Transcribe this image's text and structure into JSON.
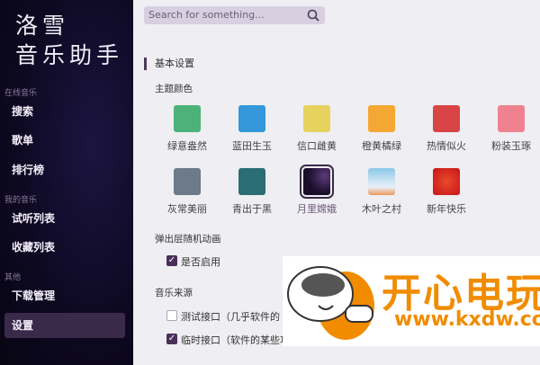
{
  "app": {
    "logo_line1": "洛雪",
    "logo_line2": "音乐助手"
  },
  "sidebar": {
    "groups": [
      {
        "label": "在线音乐"
      },
      {
        "label": "我的音乐"
      },
      {
        "label": "其他"
      }
    ],
    "items": [
      {
        "label": "搜索"
      },
      {
        "label": "歌单"
      },
      {
        "label": "排行榜"
      },
      {
        "label": "试听列表"
      },
      {
        "label": "收藏列表"
      },
      {
        "label": "下载管理"
      },
      {
        "label": "设置"
      }
    ]
  },
  "search": {
    "placeholder": "Search for something..."
  },
  "settings": {
    "section_title": "基本设置",
    "theme_label": "主题颜色",
    "themes": [
      {
        "label": "绿意盎然",
        "color": "#4cb27a"
      },
      {
        "label": "蓝田生玉",
        "color": "#3498db"
      },
      {
        "label": "信口雌黄",
        "color": "#e8d25e"
      },
      {
        "label": "橙黄橘绿",
        "color": "#f5a733"
      },
      {
        "label": "热情似火",
        "color": "#d94444"
      },
      {
        "label": "粉装玉琢",
        "color": "#f0828f"
      },
      {
        "label": "灰常美丽",
        "color": "#6c7a89"
      },
      {
        "label": "青出于黑",
        "color": "#2b6d74"
      },
      {
        "label": "月里嫦娥",
        "color": "#1a0e2a"
      },
      {
        "label": "木叶之村",
        "color": "#8cc8e8"
      },
      {
        "label": "新年快乐",
        "color": "#c8141a"
      }
    ],
    "selected_theme": "月里嫦娥",
    "popup_label": "弹出层随机动画",
    "popup_enable": {
      "label": "是否启用",
      "checked": true
    },
    "source_label": "音乐来源",
    "sources": [
      {
        "label": "测试接口（几乎软件的",
        "checked": false
      },
      {
        "label": "临时接口（软件的某些功能不可用，建议测试接口不可用再使用本接口）",
        "checked": true
      }
    ]
  },
  "watermark": {
    "title": "开心电玩",
    "url": "www.kxdw.com"
  }
}
